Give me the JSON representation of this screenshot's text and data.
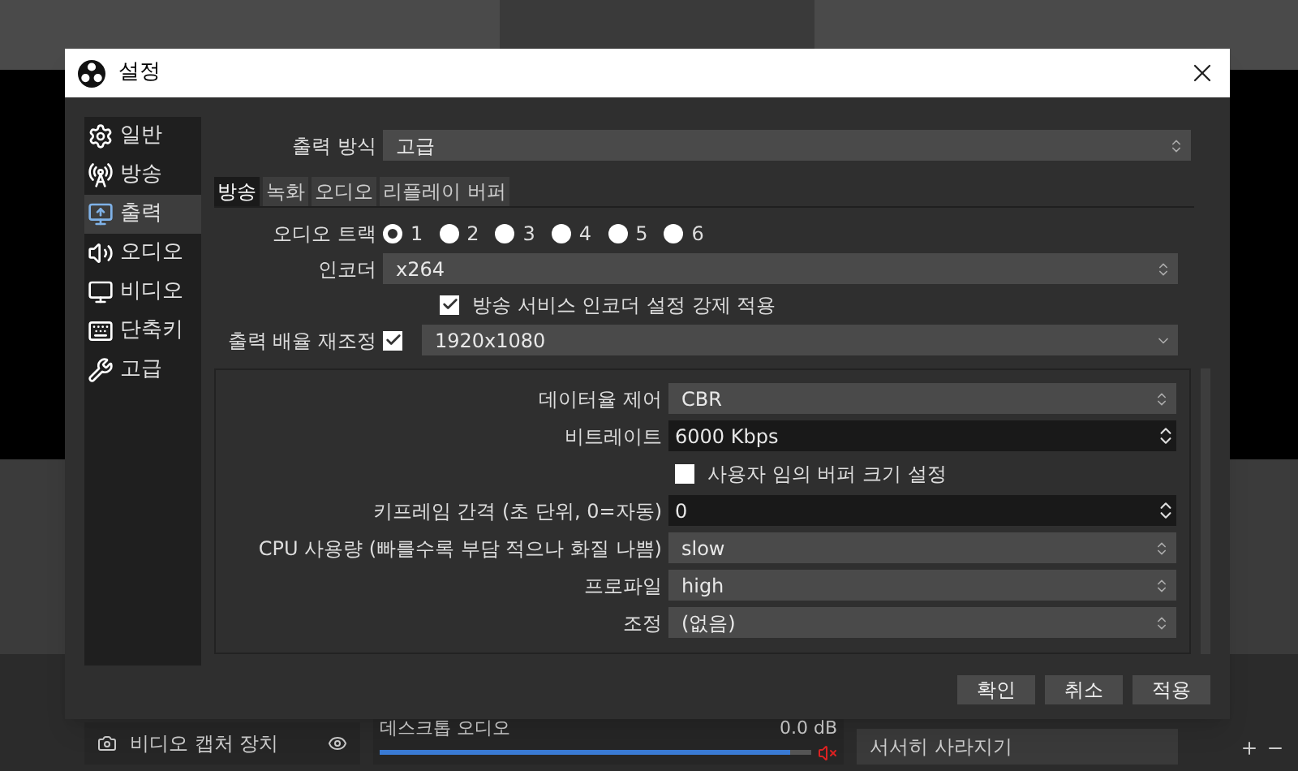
{
  "window": {
    "title": "설정"
  },
  "sidebar": {
    "items": [
      {
        "label": "일반",
        "selected": false
      },
      {
        "label": "방송",
        "selected": false
      },
      {
        "label": "출력",
        "selected": true
      },
      {
        "label": "오디오",
        "selected": false
      },
      {
        "label": "비디오",
        "selected": false
      },
      {
        "label": "단축키",
        "selected": false
      },
      {
        "label": "고급",
        "selected": false
      }
    ]
  },
  "output_mode": {
    "label": "출력 방식",
    "value": "고급"
  },
  "tabs": [
    {
      "label": "방송",
      "selected": true
    },
    {
      "label": "녹화",
      "selected": false
    },
    {
      "label": "오디오",
      "selected": false
    },
    {
      "label": "리플레이 버퍼",
      "selected": false
    }
  ],
  "audio_track": {
    "label": "오디오 트랙",
    "options": [
      {
        "label": "1",
        "selected": true
      },
      {
        "label": "2",
        "selected": false
      },
      {
        "label": "3",
        "selected": false
      },
      {
        "label": "4",
        "selected": false
      },
      {
        "label": "5",
        "selected": false
      },
      {
        "label": "6",
        "selected": false
      }
    ]
  },
  "encoder": {
    "label": "인코더",
    "value": "x264"
  },
  "enforce": {
    "label": "방송 서비스 인코더 설정 강제 적용",
    "checked": true
  },
  "rescale": {
    "label": "출력 배율 재조정",
    "checked": true,
    "value": "1920x1080"
  },
  "encoder_settings": [
    {
      "kind": "combo",
      "label": "데이터율 제어",
      "value": "CBR"
    },
    {
      "kind": "spin",
      "label": "비트레이트",
      "value": "6000 Kbps"
    },
    {
      "kind": "check",
      "label": "사용자 임의 버퍼 크기 설정",
      "checked": false
    },
    {
      "kind": "spin",
      "label": "키프레임 간격 (초 단위, 0=자동)",
      "value": "0"
    },
    {
      "kind": "combo",
      "label": "CPU 사용량 (빠를수록 부담 적으나 화질 나쁨)",
      "value": "slow"
    },
    {
      "kind": "combo",
      "label": "프로파일",
      "value": "high"
    },
    {
      "kind": "combo",
      "label": "조정",
      "value": "(없음)"
    }
  ],
  "buttons": [
    "확인",
    "취소",
    "적용"
  ],
  "background": {
    "source": "비디오 캡처 장치",
    "mixer": {
      "name": "데스크톱 오디오",
      "reading": "0.0 dB",
      "level": 0.95,
      "muted": true
    },
    "transition": "서서히 사라지기"
  }
}
